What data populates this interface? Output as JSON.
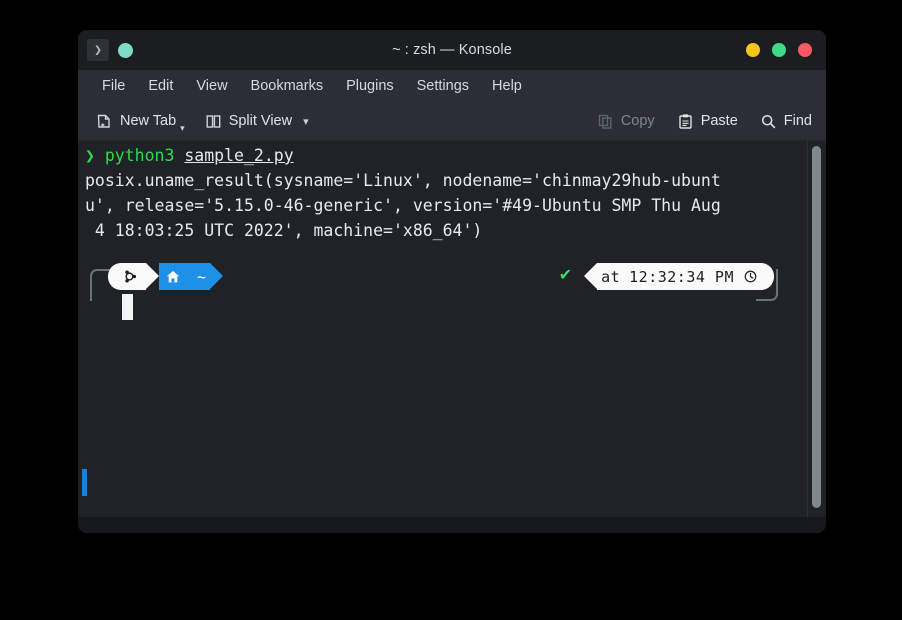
{
  "window": {
    "title": "~ : zsh — Konsole",
    "app_icon": "terminal-prompt-icon",
    "tab_indicator": "teal-dot-icon",
    "controls": [
      {
        "name": "minimize",
        "color": "#f5c518"
      },
      {
        "name": "maximize",
        "color": "#3ddc84"
      },
      {
        "name": "close",
        "color": "#fb5a64"
      }
    ]
  },
  "menubar": {
    "items": [
      {
        "label": "File"
      },
      {
        "label": "Edit"
      },
      {
        "label": "View"
      },
      {
        "label": "Bookmarks"
      },
      {
        "label": "Plugins"
      },
      {
        "label": "Settings"
      },
      {
        "label": "Help"
      }
    ]
  },
  "toolbar": {
    "new_tab": {
      "label": "New Tab",
      "icon": "new-tab-icon",
      "has_menu": true
    },
    "split_view": {
      "label": "Split View",
      "icon": "split-view-icon",
      "has_menu": true
    },
    "copy": {
      "label": "Copy",
      "icon": "copy-icon",
      "enabled": false
    },
    "paste": {
      "label": "Paste",
      "icon": "paste-icon",
      "enabled": true
    },
    "find": {
      "label": "Find",
      "icon": "search-icon",
      "enabled": true
    }
  },
  "terminal": {
    "prompt_symbol": "❯",
    "command": "python3",
    "argument": "sample_2.py",
    "output_lines": [
      "posix.uname_result(sysname='Linux', nodename='chinmay29hub-ubunt",
      "u', release='5.15.0-46-generic', version='#49-Ubuntu SMP Thu Aug",
      " 4 18:03:25 UTC 2022', machine='x86_64')"
    ],
    "prompt": {
      "status_icon": "✔",
      "os_icon": "ubuntu-logo-icon",
      "dir_icon": "home-icon",
      "dir_label": "~",
      "time_prefix": "at",
      "time_value": "12:32:34 PM",
      "clock_icon": "clock-icon"
    },
    "colors": {
      "background": "#1f2226",
      "foreground": "#e6e9ed",
      "green": "#2fd94a",
      "blue_segment": "#1e90e8",
      "white_segment": "#fafafa",
      "cursor": "#f2f4f6",
      "bottom_cursor": "#1f7fd0"
    }
  },
  "scrollbar": {
    "name": "vertical-scrollbar"
  }
}
